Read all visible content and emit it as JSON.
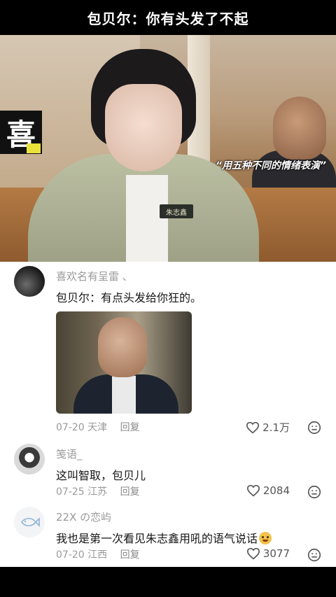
{
  "video": {
    "title": "包贝尔：你有头发了不起",
    "emotion_label": "喜",
    "caption": "“用五种不同的情绪表演”",
    "name_tag": "朱志鑫"
  },
  "comments": [
    {
      "username": "喜欢名有呈雷 、",
      "text": "包贝尔：有点头发给你狂的。",
      "has_image": true,
      "date": "07-20",
      "location": "天津",
      "reply_label": "回复",
      "likes": "2.1万"
    },
    {
      "username": "笺语_",
      "text": "这叫智取，包贝儿",
      "has_image": false,
      "date": "07-25",
      "location": "江苏",
      "reply_label": "回复",
      "likes": "2084"
    },
    {
      "username": "22X の恋屿",
      "text": "我也是第一次看见朱志鑫用吼的语气说话",
      "has_image": false,
      "date": "07-20",
      "location": "江西",
      "reply_label": "回复",
      "likes": "3077"
    }
  ],
  "icons": {
    "like": "heart-outline-icon",
    "more": "more-options-icon",
    "emoji": "smiling-face-emoji"
  }
}
